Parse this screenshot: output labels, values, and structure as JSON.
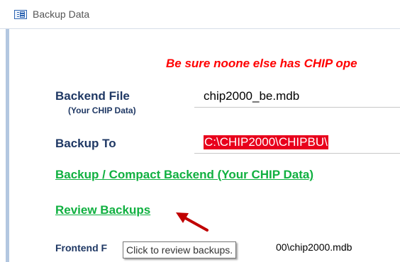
{
  "window": {
    "title": "Backup Data",
    "icon": "form-icon"
  },
  "form": {
    "warning": "Be sure noone else has CHIP ope",
    "backend_file": {
      "label": "Backend File",
      "sublabel": "(Your CHIP Data)",
      "value": "chip2000_be.mdb"
    },
    "backup_to": {
      "label": "Backup To",
      "value": "C:\\CHIP2000\\CHIPBU\\"
    },
    "backup_link": "Backup  / Compact Backend (Your CHIP Data)",
    "review_link": "Review Backups",
    "frontend": {
      "label": "Frontend F",
      "value_visible": "00\\chip2000.mdb"
    },
    "tooltip": "Click to review backups."
  },
  "colors": {
    "label": "#1f3864",
    "warning": "#ff0000",
    "link": "#10b040",
    "highlight_bg": "#e8001c",
    "arrow": "#c00000"
  }
}
